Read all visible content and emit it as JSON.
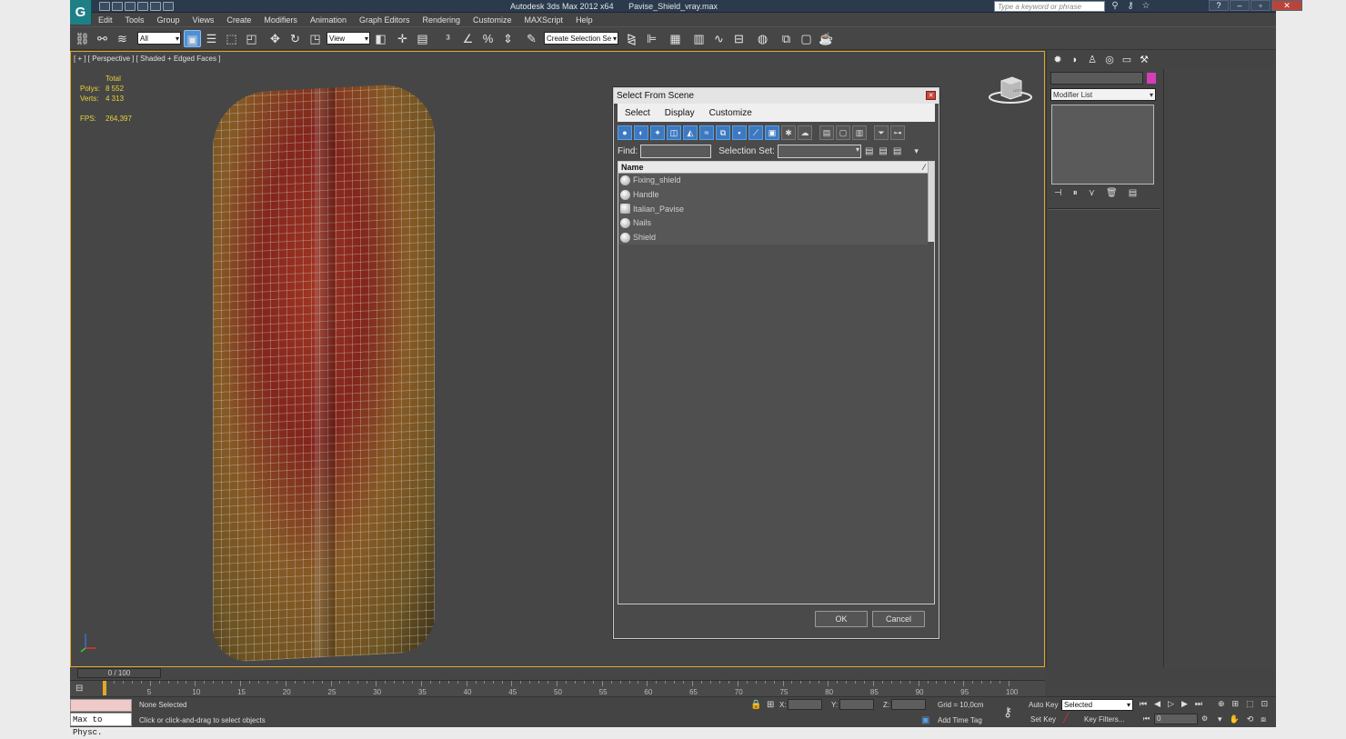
{
  "app": {
    "title": "Autodesk 3ds Max  2012 x64",
    "file": "Pavise_Shield_vray.max",
    "search_placeholder": "Type a keyword or phrase"
  },
  "menu": [
    "Edit",
    "Tools",
    "Group",
    "Views",
    "Create",
    "Modifiers",
    "Animation",
    "Graph Editors",
    "Rendering",
    "Customize",
    "MAXScript",
    "Help"
  ],
  "toolbar": {
    "filter_value": "All",
    "coord_value": "View",
    "selection_set_value": "Create Selection Se"
  },
  "viewport": {
    "label": "[ + ] [ Perspective ] [ Shaded + Edged Faces ]",
    "stats_header": "Total",
    "polys_label": "Polys:",
    "polys_value": "8 552",
    "verts_label": "Verts:",
    "verts_value": "4 313",
    "fps_label": "FPS:",
    "fps_value": "264,397",
    "cube_label": "LEFT"
  },
  "dialog": {
    "title": "Select From Scene",
    "menu": [
      "Select",
      "Display",
      "Customize"
    ],
    "find_label": "Find:",
    "selection_set_label": "Selection Set:",
    "column_name": "Name",
    "items": [
      "Fixing_shield",
      "Handle",
      "Italian_Pavise",
      "Nails",
      "Shield"
    ],
    "ok": "OK",
    "cancel": "Cancel"
  },
  "command_panel": {
    "modifier_list": "Modifier List"
  },
  "timeline": {
    "frame": "0 / 100",
    "ticks": [
      "5",
      "10",
      "15",
      "20",
      "25",
      "30",
      "35",
      "40",
      "45",
      "50",
      "55",
      "60",
      "65",
      "70",
      "75",
      "80",
      "85",
      "90",
      "95",
      "100"
    ]
  },
  "status": {
    "maxscript": "Max to Physc.",
    "selection": "None Selected",
    "prompt": "Click or click-and-drag to select objects",
    "x_label": "X:",
    "y_label": "Y:",
    "z_label": "Z:",
    "grid": "Grid = 10,0cm",
    "add_time_tag": "Add Time Tag",
    "auto_key": "Auto Key",
    "set_key": "Set Key",
    "key_mode": "Selected",
    "key_filters": "Key Filters...",
    "frame_value": "0"
  },
  "colors": {
    "viewport_border": "#e5a825",
    "stats_text": "#e7d23a",
    "object_color": "#d43fb7"
  }
}
